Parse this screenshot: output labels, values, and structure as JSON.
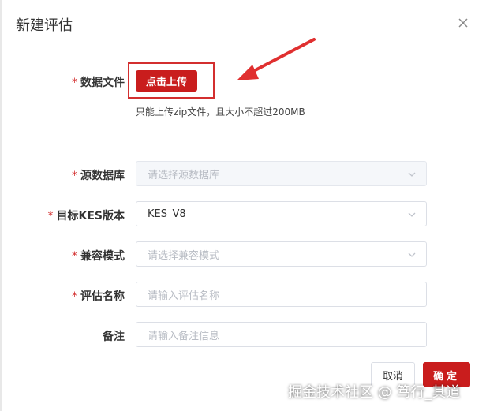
{
  "dialog": {
    "title": "新建评估",
    "close_icon": "close-icon"
  },
  "form": {
    "data_file": {
      "label": "数据文件",
      "required": "*",
      "button": "点击上传",
      "hint": "只能上传zip文件，且大小不超过200MB"
    },
    "source_db": {
      "label": "源数据库",
      "required": "*",
      "placeholder": "请选择源数据库"
    },
    "target_version": {
      "label": "目标KES版本",
      "required": "*",
      "value": "KES_V8"
    },
    "compat_mode": {
      "label": "兼容模式",
      "required": "*",
      "placeholder": "请选择兼容模式"
    },
    "eval_name": {
      "label": "评估名称",
      "required": "*",
      "placeholder": "请输入评估名称"
    },
    "remark": {
      "label": "备注",
      "placeholder": "请输入备注信息"
    }
  },
  "footer": {
    "cancel": "取消",
    "confirm": "确定"
  },
  "watermark": "掘金技术社区 @ 笃行_其道",
  "colors": {
    "accent": "#c91d1d",
    "required": "#d32f2f",
    "annotation": "#e03030"
  }
}
